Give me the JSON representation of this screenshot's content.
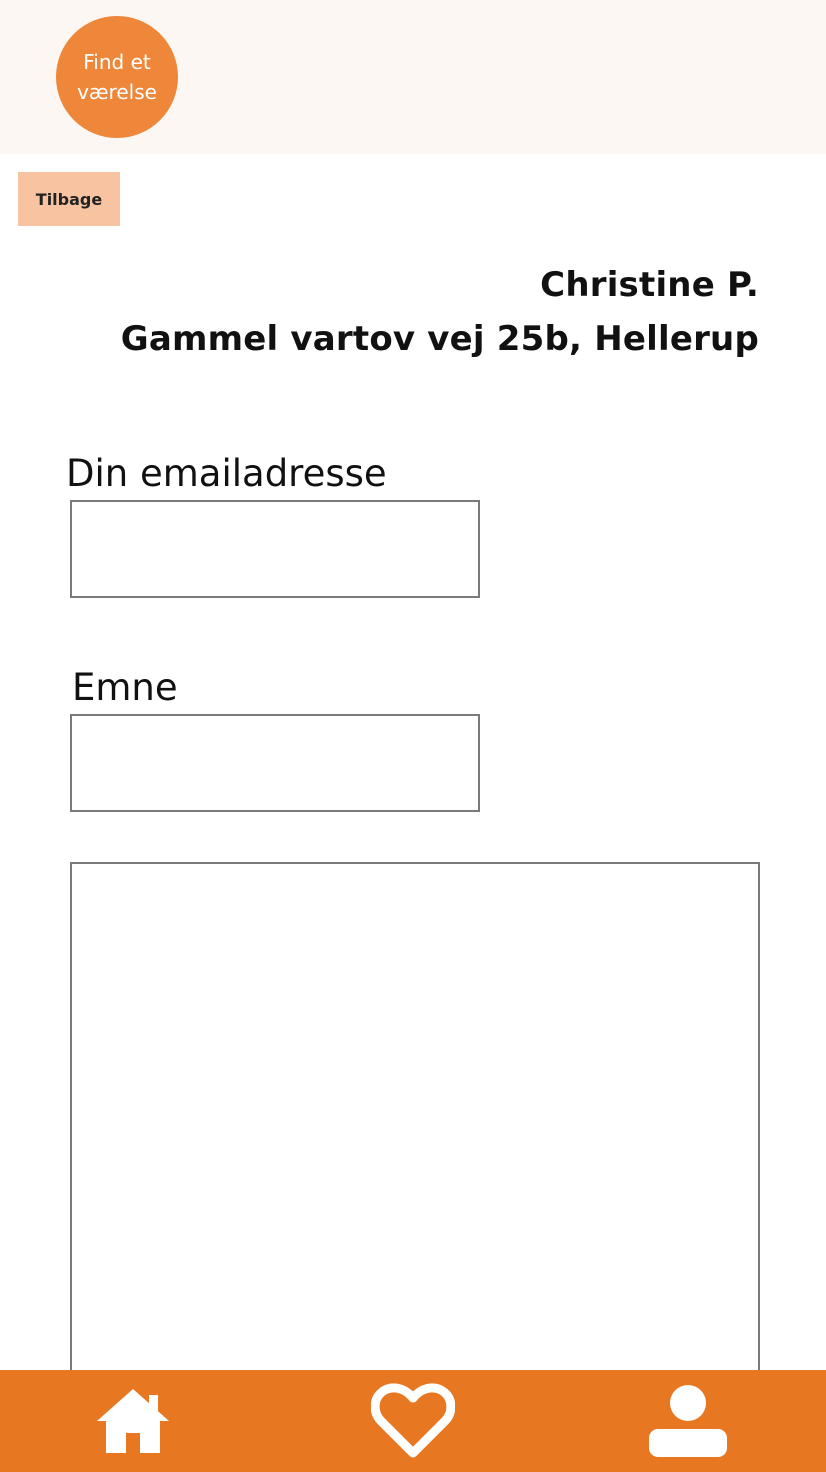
{
  "header": {
    "find_room_label": "Find et værelse"
  },
  "back_button_label": "Tilbage",
  "recipient": {
    "name": "Christine P.",
    "address": "Gammel vartov vej 25b, Hellerup"
  },
  "form": {
    "email_label": "Din emailadresse",
    "email_value": "",
    "subject_label": "Emne",
    "subject_value": "",
    "message_value": ""
  },
  "bottom_nav": {
    "items": [
      {
        "name": "home",
        "icon": "home-icon"
      },
      {
        "name": "favorites",
        "icon": "heart-icon"
      },
      {
        "name": "profile",
        "icon": "user-icon"
      }
    ]
  },
  "colors": {
    "accent": "#ef873a",
    "nav_bar": "#e87722",
    "back_button": "#f7c3a0",
    "header_bg": "#fdf7f3"
  }
}
